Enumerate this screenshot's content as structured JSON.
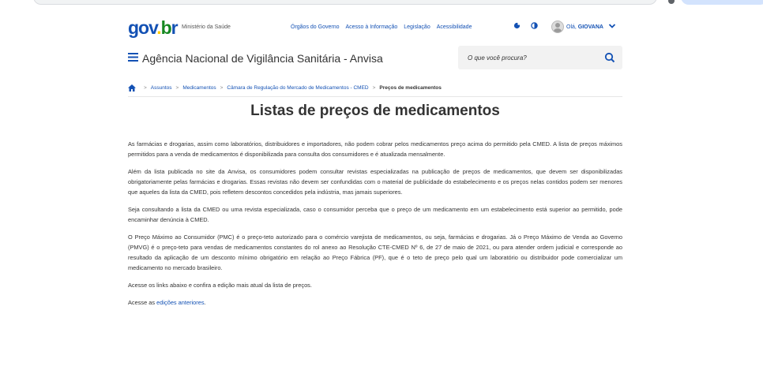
{
  "gov_bar": {
    "logo": {
      "part1": "gov",
      "part2": ".",
      "part3": "b",
      "part4": "r"
    },
    "ministry": "Ministério da Saúde",
    "links": [
      "Órgãos do Governo",
      "Acesso à Informação",
      "Legislação",
      "Acessibilidade"
    ],
    "user": {
      "greeting": "Olá,",
      "name": "GIOVANA"
    }
  },
  "header": {
    "title": "Agência Nacional de Vigilância Sanitária - Anvisa",
    "search_placeholder": "O que você procura?"
  },
  "breadcrumb": {
    "items": [
      "Assuntos",
      "Medicamentos",
      "Câmara de Regulação do Mercado de Medicamentos - CMED"
    ],
    "current": "Preços de medicamentos"
  },
  "page": {
    "title": "Listas de preços de medicamentos",
    "paragraphs": [
      "As farmácias e drogarias, assim como laboratórios, distribuidores e importadores, não podem cobrar pelos medicamentos preço acima do permitido pela CMED. A lista de preços máximos permitidos para a venda de medicamentos é disponibilizada para consulta dos consumidores e é atualizada mensalmente.",
      "Além da lista publicada no site da Anvisa, os consumidores podem consultar revistas especializadas na publicação de preços de medicamentos, que devem ser disponibilizadas obrigatoriamente pelas farmácias e drogarias. Essas revistas não devem ser confundidas com o material de publicidade do estabelecimento e os preços nelas contidos podem ser menores que aqueles da lista da CMED, pois refletem descontos concedidos pela indústria, mas jamais superiores.",
      "Seja consultando a lista da CMED ou uma revista especializada, caso o consumidor perceba que o preço de um medicamento em um estabelecimento está superior ao permitido, pode encaminhar denúncia à CMED.",
      "O Preço Máximo ao Consumidor (PMC) é o preço-teto autorizado para o comércio varejista de medicamentos, ou seja, farmácias e drogarias. Já o Preço Máximo de Venda ao Governo (PMVG) é o preço-teto para vendas de medicamentos constantes do rol anexo ao Resolução CTE-CMED Nº 6, de 27 de maio de 2021, ou para atender ordem judicial e corresponde ao resultado da aplicação de um desconto mínimo obrigatório em relação ao Preço Fábrica (PF), que é o teto de preço pelo qual um laboratório ou distribuidor pode comercializar um medicamento no mercado brasileiro.",
      "Acesse os links abaixo e confira a edição mais atual da lista de preços."
    ],
    "last_line": {
      "prefix": "Acesse as ",
      "link": "edições anteriores",
      "suffix": "."
    }
  },
  "colors": {
    "primary": "#1351b4",
    "text": "#333333",
    "yellow": "#ffcd07",
    "green": "#168821"
  }
}
